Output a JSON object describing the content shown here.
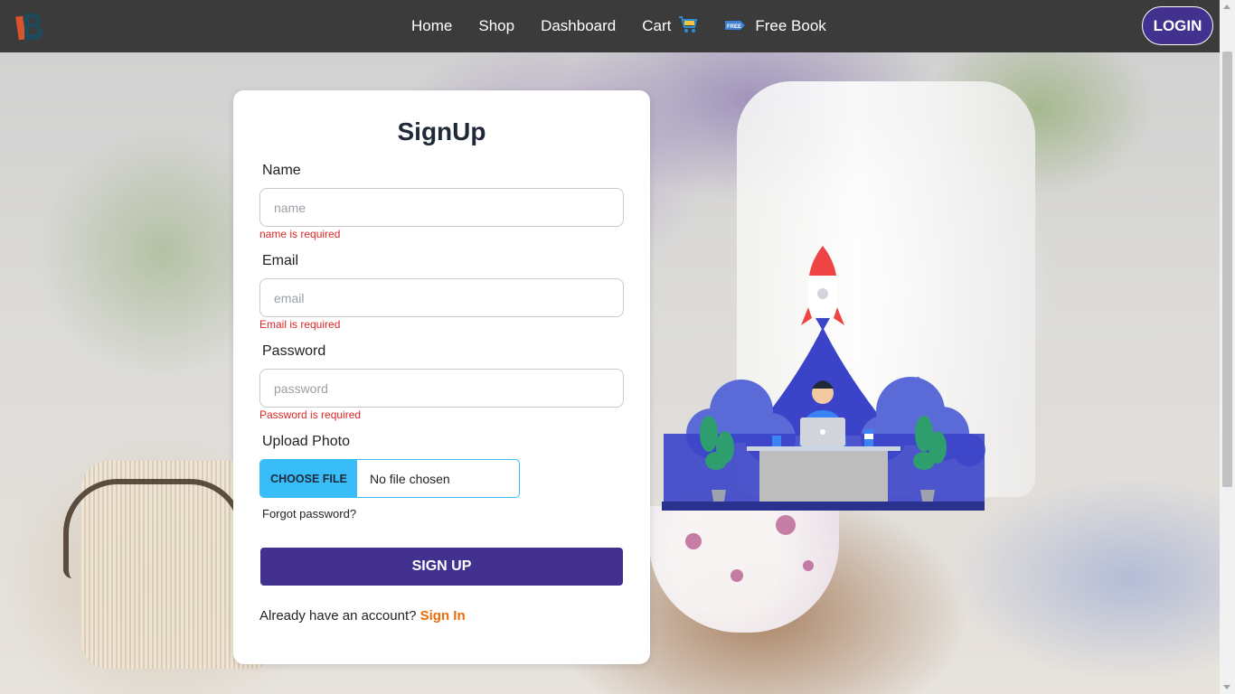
{
  "navbar": {
    "links": [
      {
        "label": "Home"
      },
      {
        "label": "Shop"
      },
      {
        "label": "Dashboard"
      },
      {
        "label": "Cart",
        "icon": "cart-icon"
      },
      {
        "label": "Free Book",
        "icon": "free-tag-icon"
      }
    ],
    "free_tag_text": "FREE",
    "login_label": "LOGIN"
  },
  "signup": {
    "title": "SignUp",
    "name_label": "Name",
    "name_placeholder": "name",
    "name_error": "name is required",
    "email_label": "Email",
    "email_placeholder": "email",
    "email_error": "Email is required",
    "password_label": "Password",
    "password_placeholder": "password",
    "password_error": "Password is required",
    "photo_label": "Upload Photo",
    "file_button": "CHOOSE FILE",
    "file_status": "No file chosen",
    "forgot_password": "Forgot password?",
    "submit_label": "SIGN UP",
    "account_prompt": "Already have an account?",
    "signin_link": "Sign In"
  },
  "colors": {
    "navbar": "#3b3b3b",
    "primary": "#43318f",
    "error": "#dc2626",
    "file_button": "#38bdf8",
    "link_accent": "#ea6a0c"
  }
}
